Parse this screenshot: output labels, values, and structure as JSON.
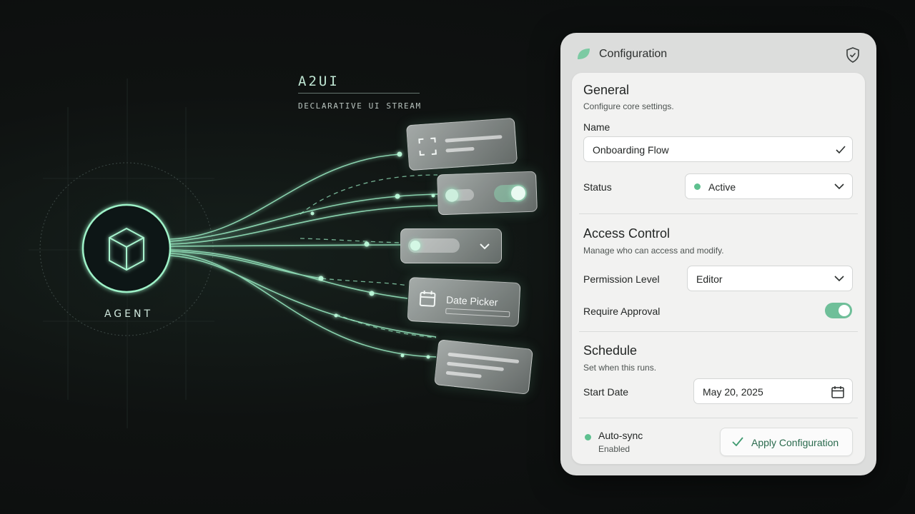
{
  "stream": {
    "title": "A2UI",
    "subtitle": "DECLARATIVE UI STREAM",
    "agent_label": "AGENT",
    "date_picker_label": "Date Picker"
  },
  "panel": {
    "title": "Configuration",
    "general": {
      "heading": "General",
      "description": "Configure core settings.",
      "name_label": "Name",
      "name_value": "Onboarding Flow",
      "status_label": "Status",
      "status_value": "Active"
    },
    "access": {
      "heading": "Access Control",
      "description": "Manage who can access and modify.",
      "permission_label": "Permission Level",
      "permission_value": "Editor",
      "approval_label": "Require Approval",
      "approval_on": true
    },
    "schedule": {
      "heading": "Schedule",
      "description": "Set when this runs.",
      "start_label": "Start Date",
      "start_value": "May 20, 2025"
    },
    "footer": {
      "sync_title": "Auto-sync",
      "sync_status": "Enabled",
      "apply_label": "Apply Configuration"
    }
  },
  "colors": {
    "accent": "#6fbf99",
    "glow": "#8ff0c0",
    "status_dot": "#5ec08f"
  }
}
